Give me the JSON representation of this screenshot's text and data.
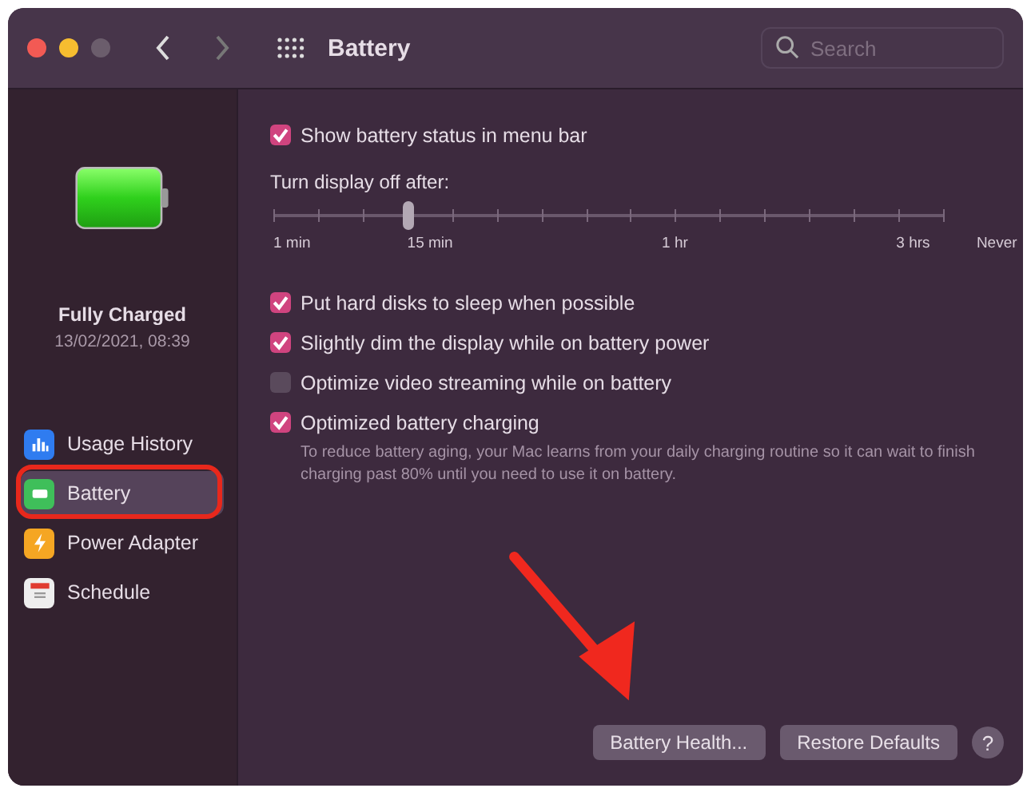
{
  "window": {
    "title": "Battery"
  },
  "search": {
    "placeholder": "Search"
  },
  "sidebar": {
    "status": "Fully Charged",
    "timestamp": "13/02/2021, 08:39",
    "items": [
      {
        "label": "Usage History",
        "kind": "usage",
        "selected": false
      },
      {
        "label": "Battery",
        "kind": "battery",
        "selected": true
      },
      {
        "label": "Power Adapter",
        "kind": "adapter",
        "selected": false
      },
      {
        "label": "Schedule",
        "kind": "schedule",
        "selected": false
      }
    ]
  },
  "options_top": [
    {
      "label": "Show battery status in menu bar",
      "checked": true
    }
  ],
  "display_slider": {
    "label": "Turn display off after:",
    "level": 0.2,
    "ticks": [
      "1 min",
      "15 min",
      "1 hr",
      "3 hrs",
      "Never"
    ]
  },
  "options": [
    {
      "label": "Put hard disks to sleep when possible",
      "checked": true
    },
    {
      "label": "Slightly dim the display while on battery power",
      "checked": true
    },
    {
      "label": "Optimize video streaming while on battery",
      "checked": false
    },
    {
      "label": "Optimized battery charging",
      "checked": true,
      "description": "To reduce battery aging, your Mac learns from your daily charging routine so it can wait to finish charging past 80% until you need to use it on battery."
    }
  ],
  "buttons": [
    "Battery Health...",
    "Restore Defaults"
  ],
  "help_button": "?"
}
